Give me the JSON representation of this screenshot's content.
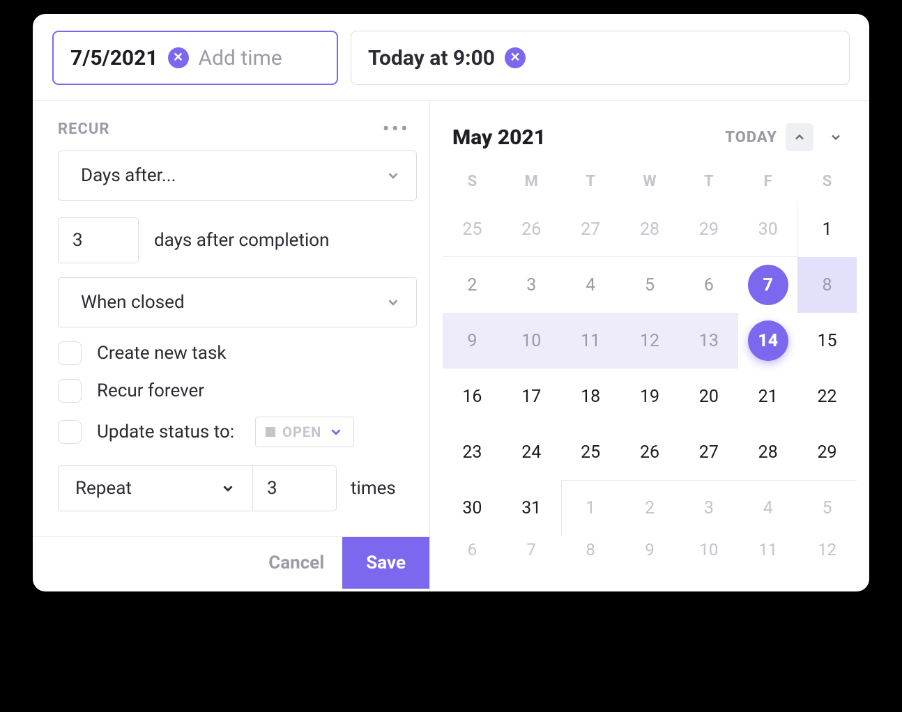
{
  "top": {
    "start": {
      "date_value": "7/5/2021",
      "add_time_placeholder": "Add time"
    },
    "end": {
      "text": "Today at 9:00"
    }
  },
  "recur": {
    "title": "RECUR",
    "mode_label": "Days after...",
    "days_value": "3",
    "days_suffix": "days after completion",
    "trigger_label": "When closed",
    "options": {
      "create_new_task": "Create new task",
      "recur_forever": "Recur forever",
      "update_status_to": "Update status to:"
    },
    "status_chip": {
      "label": "OPEN"
    },
    "repeat": {
      "label": "Repeat",
      "count": "3",
      "suffix": "times"
    }
  },
  "footer": {
    "cancel": "Cancel",
    "save": "Save"
  },
  "calendar": {
    "month_label": "May 2021",
    "today_label": "TODAY",
    "dow": [
      "S",
      "M",
      "T",
      "W",
      "T",
      "F",
      "S"
    ],
    "weeks": [
      [
        {
          "n": "25",
          "out": true
        },
        {
          "n": "26",
          "out": true
        },
        {
          "n": "27",
          "out": true
        },
        {
          "n": "28",
          "out": true
        },
        {
          "n": "29",
          "out": true
        },
        {
          "n": "30",
          "out": true
        },
        {
          "n": "1"
        }
      ],
      [
        {
          "n": "2",
          "muted": true
        },
        {
          "n": "3",
          "muted": true
        },
        {
          "n": "4",
          "muted": true
        },
        {
          "n": "5",
          "muted": true
        },
        {
          "n": "6",
          "muted": true
        },
        {
          "n": "7",
          "selected": true,
          "ring": true
        },
        {
          "n": "8",
          "range": "dark",
          "muted": true
        }
      ],
      [
        {
          "n": "9",
          "range": "light",
          "muted": true
        },
        {
          "n": "10",
          "range": "light",
          "muted": true
        },
        {
          "n": "11",
          "range": "light",
          "muted": true
        },
        {
          "n": "12",
          "range": "light",
          "muted": true
        },
        {
          "n": "13",
          "range": "light",
          "muted": true
        },
        {
          "n": "14",
          "selected": true
        },
        {
          "n": "15"
        }
      ],
      [
        {
          "n": "16"
        },
        {
          "n": "17"
        },
        {
          "n": "18"
        },
        {
          "n": "19"
        },
        {
          "n": "20"
        },
        {
          "n": "21"
        },
        {
          "n": "22"
        }
      ],
      [
        {
          "n": "23"
        },
        {
          "n": "24"
        },
        {
          "n": "25"
        },
        {
          "n": "26"
        },
        {
          "n": "27"
        },
        {
          "n": "28"
        },
        {
          "n": "29"
        }
      ],
      [
        {
          "n": "30"
        },
        {
          "n": "31"
        },
        {
          "n": "1",
          "out": true
        },
        {
          "n": "2",
          "out": true
        },
        {
          "n": "3",
          "out": true
        },
        {
          "n": "4",
          "out": true
        },
        {
          "n": "5",
          "out": true
        }
      ],
      [
        {
          "n": "6",
          "out": true
        },
        {
          "n": "7",
          "out": true
        },
        {
          "n": "8",
          "out": true
        },
        {
          "n": "9",
          "out": true
        },
        {
          "n": "10",
          "out": true
        },
        {
          "n": "11",
          "out": true
        },
        {
          "n": "12",
          "out": true
        }
      ]
    ]
  }
}
